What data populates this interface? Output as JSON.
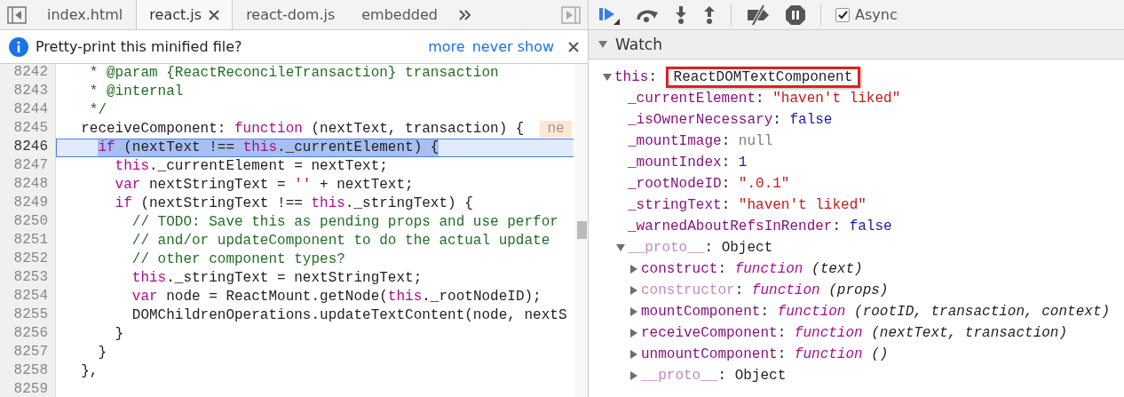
{
  "editor": {
    "tabs": [
      {
        "label": "index.html",
        "selected": false
      },
      {
        "label": "react.js",
        "selected": true
      },
      {
        "label": "react-dom.js",
        "selected": false
      },
      {
        "label": "embedded",
        "selected": false
      }
    ],
    "infobar": {
      "message": "Pretty-print this minified file?",
      "links": [
        "more",
        "never show"
      ]
    },
    "lines": [
      {
        "number": "8242",
        "selected": false,
        "tokens": [
          {
            "kind": "comment",
            "text": "   * @param {ReactReconcileTransaction} transaction"
          }
        ]
      },
      {
        "number": "8243",
        "selected": false,
        "tokens": [
          {
            "kind": "comment",
            "text": "   * @internal"
          }
        ]
      },
      {
        "number": "8244",
        "selected": false,
        "tokens": [
          {
            "kind": "comment",
            "text": "   */"
          }
        ]
      },
      {
        "number": "8245",
        "selected": false,
        "inline_value": "ne",
        "tokens": [
          {
            "kind": "plain",
            "text": "  receiveComponent: "
          },
          {
            "kind": "keyword",
            "text": "function"
          },
          {
            "kind": "plain",
            "text": " (nextText, transaction) {"
          }
        ]
      },
      {
        "number": "8246",
        "selected": true,
        "tokens": [
          {
            "kind": "keyword",
            "text": "    if"
          },
          {
            "kind": "plain",
            "text": " (nextText !== "
          },
          {
            "kind": "keyword",
            "text": "this"
          },
          {
            "kind": "plain",
            "text": "._currentElement) {"
          }
        ]
      },
      {
        "number": "8247",
        "selected": false,
        "tokens": [
          {
            "kind": "keyword",
            "text": "      this"
          },
          {
            "kind": "plain",
            "text": "._currentElement = nextText;"
          }
        ]
      },
      {
        "number": "8248",
        "selected": false,
        "tokens": [
          {
            "kind": "keyword",
            "text": "      var"
          },
          {
            "kind": "plain",
            "text": " nextStringText = "
          },
          {
            "kind": "string",
            "text": "''"
          },
          {
            "kind": "plain",
            "text": " + nextText;"
          }
        ]
      },
      {
        "number": "8249",
        "selected": false,
        "tokens": [
          {
            "kind": "keyword",
            "text": "      if"
          },
          {
            "kind": "plain",
            "text": " (nextStringText !== "
          },
          {
            "kind": "keyword",
            "text": "this"
          },
          {
            "kind": "plain",
            "text": "._stringText) {"
          }
        ]
      },
      {
        "number": "8250",
        "selected": false,
        "tokens": [
          {
            "kind": "comment",
            "text": "        // TODO: Save this as pending props and use perfor"
          }
        ]
      },
      {
        "number": "8251",
        "selected": false,
        "tokens": [
          {
            "kind": "comment",
            "text": "        // and/or updateComponent to do the actual update"
          }
        ]
      },
      {
        "number": "8252",
        "selected": false,
        "tokens": [
          {
            "kind": "comment",
            "text": "        // other component types?"
          }
        ]
      },
      {
        "number": "8253",
        "selected": false,
        "tokens": [
          {
            "kind": "keyword",
            "text": "        this"
          },
          {
            "kind": "plain",
            "text": "._stringText = nextStringText;"
          }
        ]
      },
      {
        "number": "8254",
        "selected": false,
        "tokens": [
          {
            "kind": "keyword",
            "text": "        var"
          },
          {
            "kind": "plain",
            "text": " node = ReactMount.getNode("
          },
          {
            "kind": "keyword",
            "text": "this"
          },
          {
            "kind": "plain",
            "text": "._rootNodeID);"
          }
        ]
      },
      {
        "number": "8255",
        "selected": false,
        "tokens": [
          {
            "kind": "plain",
            "text": "        DOMChildrenOperations.updateTextContent(node, nextS"
          }
        ]
      },
      {
        "number": "8256",
        "selected": false,
        "tokens": [
          {
            "kind": "plain",
            "text": "      }"
          }
        ]
      },
      {
        "number": "8257",
        "selected": false,
        "tokens": [
          {
            "kind": "plain",
            "text": "    }"
          }
        ]
      },
      {
        "number": "8258",
        "selected": false,
        "tokens": [
          {
            "kind": "plain",
            "text": "  },"
          }
        ]
      },
      {
        "number": "8259",
        "selected": false
      }
    ]
  },
  "debugger": {
    "async": {
      "label": "Async",
      "checked": true
    },
    "watch": {
      "title": "Watch",
      "expanded": true,
      "items": [
        {
          "name": "this",
          "separator": ":",
          "enumerable": true,
          "kind": "object",
          "value": "ReactDOMTextComponent",
          "highlighted": true,
          "expanded": true,
          "children": [
            {
              "name": "_currentElement",
              "separator": ":",
              "enumerable": true,
              "kind": "string",
              "value": "\"haven't liked\""
            },
            {
              "name": "_isOwnerNecessary",
              "separator": ":",
              "enumerable": true,
              "kind": "boolean",
              "value": "false"
            },
            {
              "name": "_mountImage",
              "separator": ":",
              "enumerable": true,
              "kind": "null",
              "value": "null"
            },
            {
              "name": "_mountIndex",
              "separator": ":",
              "enumerable": true,
              "kind": "number",
              "value": "1"
            },
            {
              "name": "_rootNodeID",
              "separator": ":",
              "enumerable": true,
              "kind": "string",
              "value": "\".0.1\""
            },
            {
              "name": "_stringText",
              "separator": ":",
              "enumerable": true,
              "kind": "string",
              "value": "\"haven't liked\""
            },
            {
              "name": "_warnedAboutRefsInRender",
              "separator": ":",
              "enumerable": true,
              "kind": "boolean",
              "value": "false"
            },
            {
              "name": "__proto__",
              "separator": ":",
              "enumerable": false,
              "kind": "object",
              "value": "Object",
              "expanded": true,
              "children": [
                {
                  "name": "construct",
                  "separator": ":",
                  "enumerable": true,
                  "kind": "function",
                  "keyword": "function",
                  "value": "(text)",
                  "expanded": false
                },
                {
                  "name": "constructor",
                  "separator": ":",
                  "enumerable": false,
                  "kind": "function",
                  "keyword": "function",
                  "value": "(props)",
                  "expanded": false
                },
                {
                  "name": "mountComponent",
                  "separator": ":",
                  "enumerable": true,
                  "kind": "function",
                  "keyword": "function",
                  "value": "(rootID, transaction, context)",
                  "expanded": false
                },
                {
                  "name": "receiveComponent",
                  "separator": ":",
                  "enumerable": true,
                  "kind": "function",
                  "keyword": "function",
                  "value": "(nextText, transaction)",
                  "expanded": false
                },
                {
                  "name": "unmountComponent",
                  "separator": ":",
                  "enumerable": true,
                  "kind": "function",
                  "keyword": "function",
                  "value": "()",
                  "expanded": false
                },
                {
                  "name": "__proto__",
                  "separator": ":",
                  "enumerable": false,
                  "kind": "object",
                  "value": "Object",
                  "expanded": false
                }
              ]
            }
          ]
        }
      ]
    }
  }
}
